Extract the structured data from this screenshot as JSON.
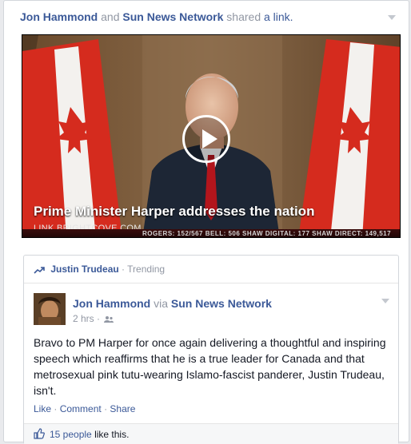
{
  "story": {
    "actor1": "Jon Hammond",
    "connector": "and",
    "actor2": "Sun News Network",
    "verb": "shared",
    "object": "a link."
  },
  "video": {
    "title": "Prime Minister Harper addresses the nation",
    "domain": "LINK.BRIGHTCOVE.COM",
    "ticker": "ROGERS: 152/567     BELL: 506     SHAW DIGITAL: 177     SHAW DIRECT: 149,517"
  },
  "trending": {
    "topic": "Justin Trudeau",
    "separator": "·",
    "label": "Trending"
  },
  "post": {
    "author": "Jon Hammond",
    "via": "via",
    "page": "Sun News Network",
    "time": "2 hrs ·",
    "text": "Bravo to PM Harper for once again delivering a thoughtful and inspiring speech which reaffirms that he is a true leader for Canada and that metrosexual pink tutu-wearing Islamo-fascist panderer, Justin Trudeau, isn't."
  },
  "actions": {
    "like": "Like",
    "comment": "Comment",
    "share": "Share",
    "dot": "·"
  },
  "likes": {
    "count": "15 people",
    "suffix": "like this."
  },
  "colors": {
    "link": "#3b5998",
    "muted": "#9197a3",
    "flag_red": "#d52b1e"
  }
}
